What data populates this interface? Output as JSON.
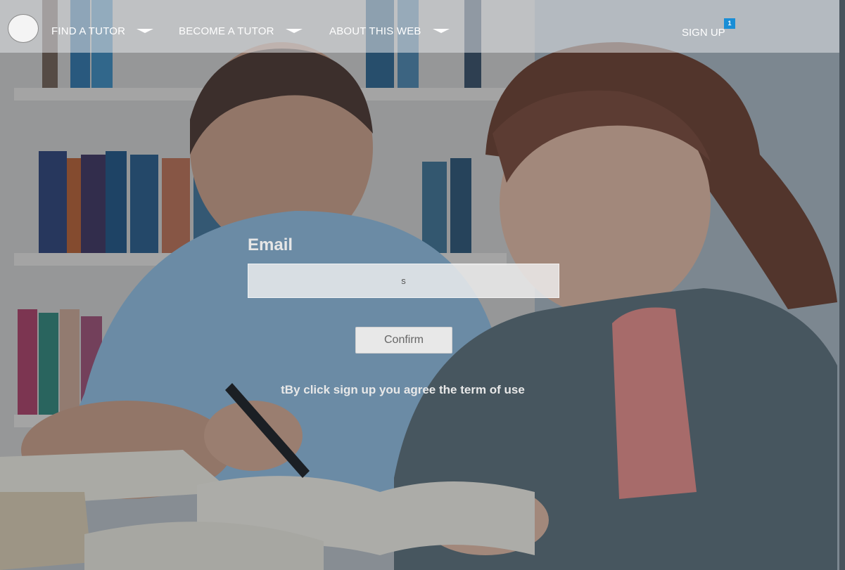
{
  "nav": {
    "items": [
      {
        "label": "FIND A TUTOR"
      },
      {
        "label": "BECOME A TUTOR"
      },
      {
        "label": "ABOUT THIS WEB"
      }
    ],
    "signup_label": "SIGN UP",
    "signup_badge": "1",
    "badge_color": "#1a8ed6"
  },
  "form": {
    "email_label": "Email",
    "email_value": "s",
    "confirm_label": "Confirm",
    "terms_text": "tBy click sign up you agree the term of use"
  },
  "icons": {
    "logo": "logo-circle",
    "dropdown": "chevron-down-icon"
  }
}
